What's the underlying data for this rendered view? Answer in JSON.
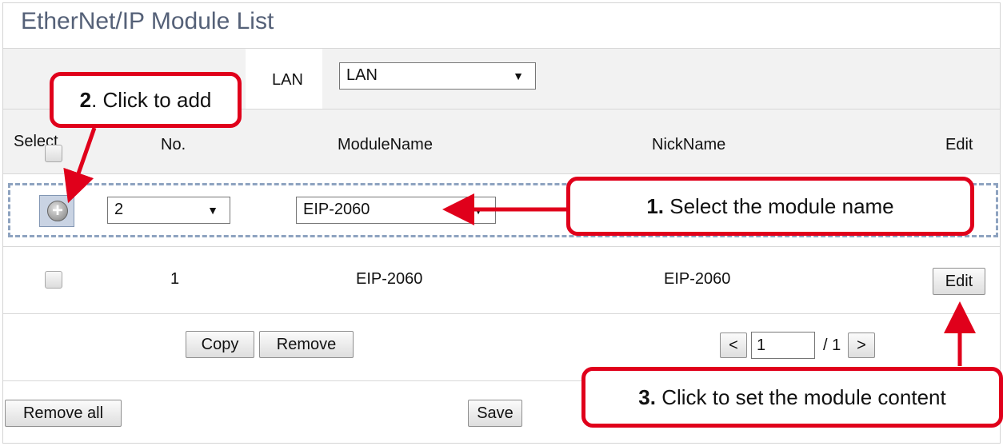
{
  "title": "EtherNet/IP Module List",
  "lan": {
    "label": "LAN",
    "selected": "LAN"
  },
  "headers": {
    "select": "Select",
    "no": "No.",
    "module_name": "ModuleName",
    "nick_name": "NickName",
    "edit": "Edit"
  },
  "new_row": {
    "no": "2",
    "module_name": "EIP-2060"
  },
  "rows": [
    {
      "no": "1",
      "module_name": "EIP-2060",
      "nick_name": "EIP-2060",
      "edit_label": "Edit"
    }
  ],
  "actions": {
    "copy": "Copy",
    "remove": "Remove",
    "remove_all": "Remove all",
    "save": "Save"
  },
  "pagination": {
    "prev": "<",
    "page": "1",
    "total": "/ 1",
    "next": ">"
  },
  "callouts": {
    "step1": {
      "num": "1.",
      "text": " Select the module name"
    },
    "step2": {
      "num": "2",
      "text": ". Click to add"
    },
    "step3": {
      "num": "3.",
      "text": " Click to set the module content"
    }
  },
  "colors": {
    "callout_red": "#e0001b",
    "title": "#556178",
    "dash": "#8ea3c0"
  },
  "icons": {
    "add": "plus-circle-icon"
  }
}
